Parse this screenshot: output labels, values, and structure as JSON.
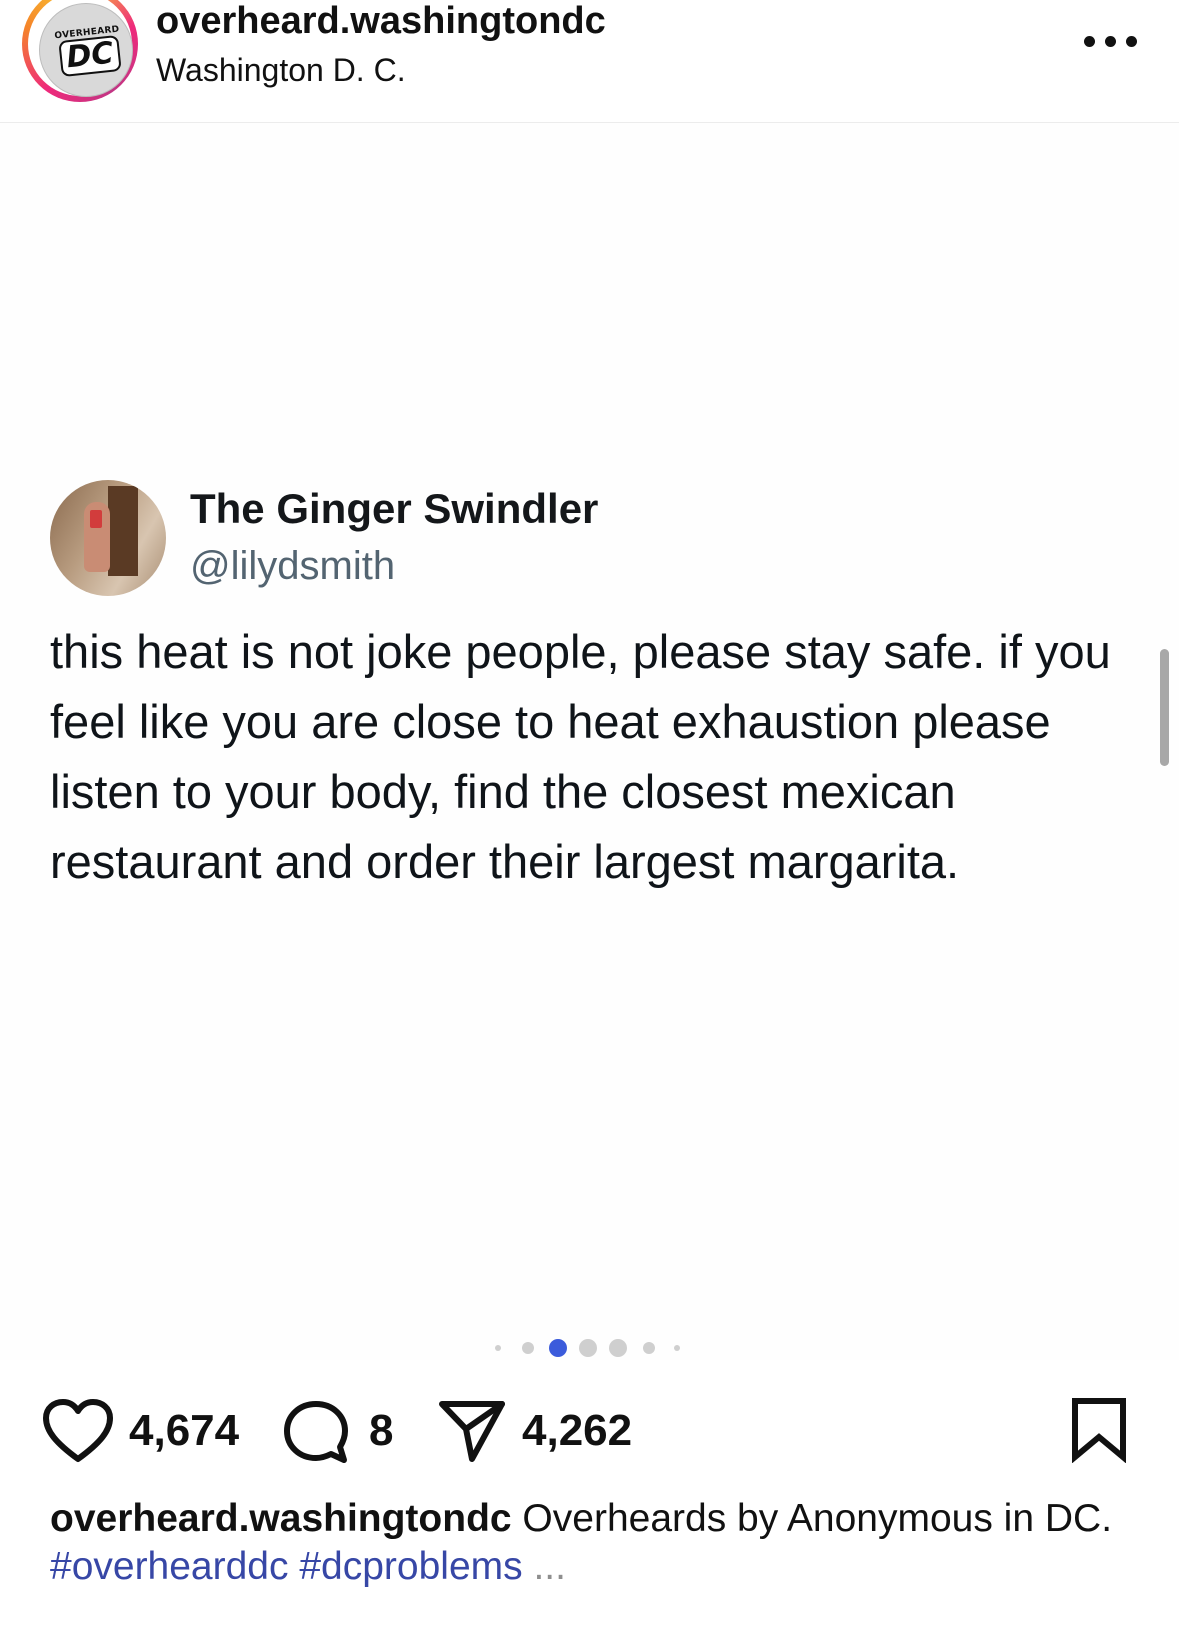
{
  "header": {
    "account_name": "overheard.washingtondc",
    "location": "Washington D. C.",
    "logo_top_text": "OVERHEARD",
    "logo_main_text": "DC",
    "more_icon": "more-horizontal-icon"
  },
  "tweet": {
    "display_name": "The Ginger Swindler",
    "handle": "@lilydsmith",
    "text": "this heat is not joke people, please stay safe. if you feel like you are close to heat exhaustion please listen to your body, find the closest mexican restaurant and order their largest margarita."
  },
  "carousel": {
    "current_slide": 2,
    "total_dots": 7,
    "active_color": "#3b5bdb"
  },
  "actions": {
    "like_icon": "heart-icon",
    "like_count": "4,674",
    "comment_icon": "comment-icon",
    "comment_count": "8",
    "share_icon": "send-icon",
    "share_count": "4,262",
    "save_icon": "bookmark-icon"
  },
  "caption": {
    "username": "overheard.washingtondc",
    "text": " Overheards by Anonymous in DC. ",
    "hashtags": [
      "#overhearddc",
      "#dcproblems"
    ],
    "more": "..."
  },
  "colors": {
    "hashtag": "#3747a6",
    "handle_gray": "#536471",
    "story_ring": [
      "#f9ce34",
      "#ee2a7b",
      "#c13584"
    ]
  }
}
